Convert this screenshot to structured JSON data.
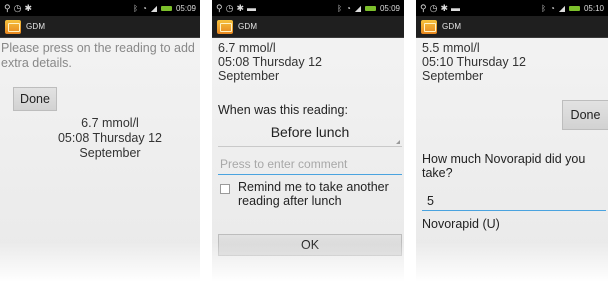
{
  "status_bar": {
    "screen1": {
      "time": "05:09",
      "left_icons": [
        "usb-icon",
        "clock-icon",
        "android-debug-icon"
      ],
      "right_icons": [
        "bluetooth-icon",
        "wifi-icon",
        "signal-icon",
        "battery-icon"
      ]
    },
    "screen2": {
      "time": "05:09",
      "left_icons": [
        "usb-icon",
        "clock-icon",
        "android-debug-icon",
        "image-icon"
      ],
      "right_icons": [
        "bluetooth-icon",
        "wifi-icon",
        "signal-icon",
        "battery-icon"
      ]
    },
    "screen3": {
      "time": "05:10",
      "left_icons": [
        "usb-icon",
        "clock-icon",
        "android-debug-icon",
        "image-icon"
      ],
      "right_icons": [
        "bluetooth-icon",
        "wifi-icon",
        "signal-icon",
        "battery-icon"
      ]
    }
  },
  "app": {
    "title": "GDM",
    "icon": "gdm-app-icon"
  },
  "screen1": {
    "prompt": "Please press on the reading to add extra details.",
    "done_label": "Done",
    "reading": {
      "value": "6.7 mmol/l",
      "time": "05:08 Thursday 12",
      "date": "September"
    }
  },
  "screen2": {
    "reading": {
      "value": "6.7 mmol/l",
      "time": "05:08 Thursday 12",
      "date": "September"
    },
    "question": "When was this reading:",
    "spinner_value": "Before lunch",
    "comment_placeholder": "Press to enter comment",
    "reminder_checked": false,
    "reminder_label": "Remind me to take another reading after lunch",
    "ok_label": "OK"
  },
  "screen3": {
    "reading": {
      "value": "5.5 mmol/l",
      "time": "05:10 Thursday 12",
      "date": "September"
    },
    "done_label": "Done",
    "question": "How much Novorapid did you take?",
    "input_value": "5",
    "unit_label": "Novorapid (U)"
  },
  "colors": {
    "status_bar": "#000000",
    "action_bar": "#1f1f1f",
    "focus_underline": "#4aa3df",
    "battery": "#7cbf2b"
  }
}
